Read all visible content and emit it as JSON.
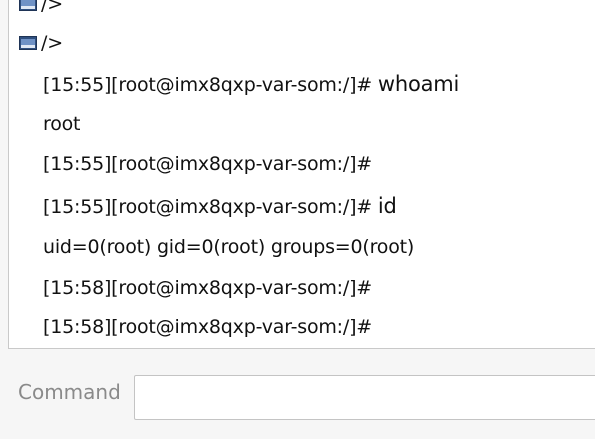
{
  "terminal": {
    "dir_lines": [
      {
        "icon": "folder-icon",
        "text": "/>"
      },
      {
        "icon": "folder-icon",
        "text": "/>"
      }
    ],
    "lines": [
      {
        "prompt": "[15:55][root@imx8qxp-var-som:/]# ",
        "command": "whoami"
      },
      {
        "prompt": "root",
        "command": ""
      },
      {
        "prompt": "[15:55][root@imx8qxp-var-som:/]#",
        "command": ""
      },
      {
        "prompt": "[15:55][root@imx8qxp-var-som:/]# ",
        "command": "id"
      },
      {
        "prompt": "uid=0(root) gid=0(root) groups=0(root)",
        "command": ""
      },
      {
        "prompt": "[15:58][root@imx8qxp-var-som:/]#",
        "command": ""
      },
      {
        "prompt": "[15:58][root@imx8qxp-var-som:/]#",
        "command": ""
      }
    ]
  },
  "command_bar": {
    "label": "Command",
    "input_value": "",
    "placeholder": ""
  }
}
